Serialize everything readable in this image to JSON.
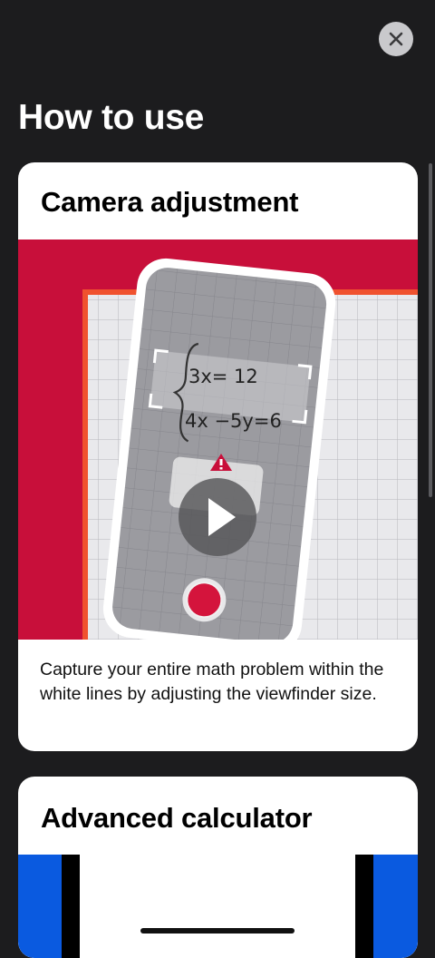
{
  "header": {
    "close_label": "Close"
  },
  "page": {
    "title": "How to use"
  },
  "cards": [
    {
      "title": "Camera adjustment",
      "equations": [
        "3x= 12",
        "4x −5y=6"
      ],
      "description": "Capture your entire math problem within the white lines by adjusting the viewfinder size.",
      "media_state": "paused"
    },
    {
      "title": "Advanced calculator"
    }
  ],
  "icons": {
    "close": "close-icon",
    "play": "play-icon",
    "warning": "warning-icon",
    "shutter": "shutter-button"
  },
  "colors": {
    "background": "#1c1c1e",
    "card": "#ffffff",
    "media_red": "#c80f3a",
    "accent_orange": "#f0522f",
    "shutter_red": "#d4143c",
    "calculator_blue": "#0a5ae0"
  }
}
